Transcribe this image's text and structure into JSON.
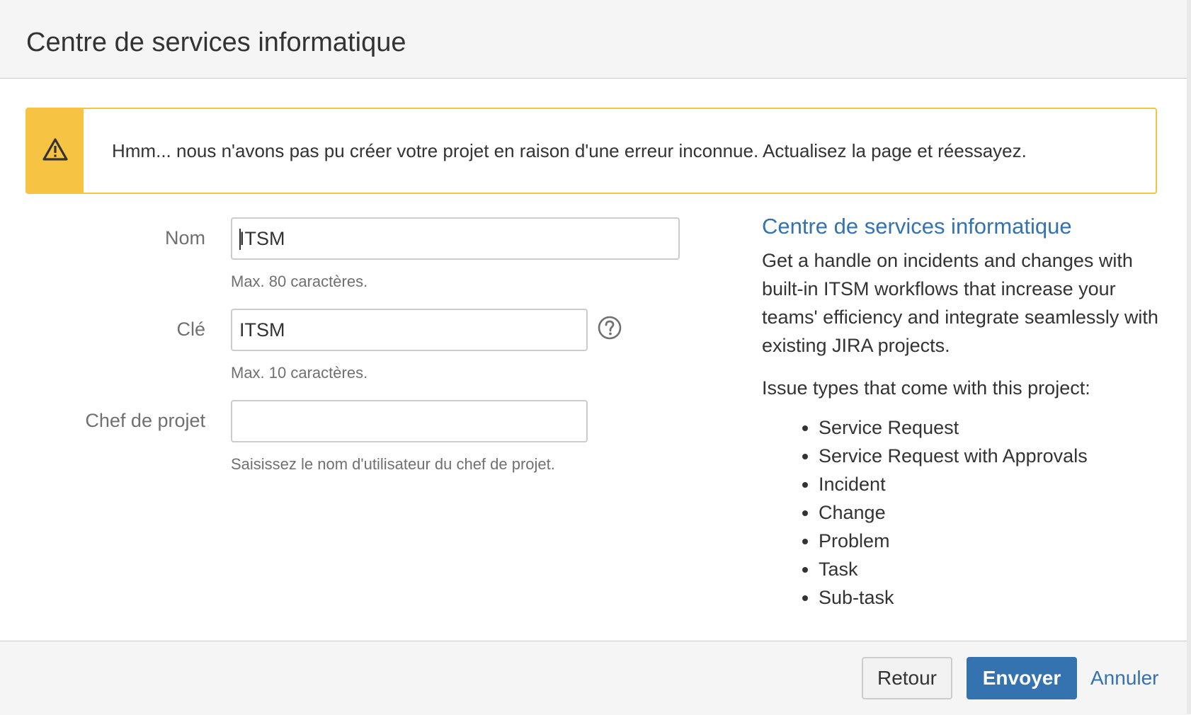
{
  "dialog": {
    "title": "Centre de services informatique"
  },
  "warning": {
    "icon": "warning-triangle-icon",
    "message": "Hmm... nous n'avons pas pu créer votre projet en raison d'une erreur inconnue. Actualisez la page et réessayez.",
    "color": "#f6c342"
  },
  "form": {
    "name": {
      "label": "Nom",
      "value": "ITSM",
      "hint": "Max. 80 caractères."
    },
    "key": {
      "label": "Clé",
      "value": "ITSM",
      "hint": "Max. 10 caractères.",
      "help_icon": "question-circle-icon"
    },
    "lead": {
      "label": "Chef de projet",
      "value": "",
      "hint": "Saisissez le nom d'utilisateur du chef de projet."
    }
  },
  "info": {
    "title": "Centre de services informatique",
    "description": "Get a handle on incidents and changes with built-in ITSM workflows that increase your teams' efficiency and integrate seamlessly with existing JIRA projects.",
    "issue_types_heading": "Issue types that come with this project:",
    "issue_types": [
      "Service Request",
      "Service Request with Approvals",
      "Incident",
      "Change",
      "Problem",
      "Task",
      "Sub-task"
    ]
  },
  "footer": {
    "back_label": "Retour",
    "submit_label": "Envoyer",
    "cancel_label": "Annuler"
  },
  "colors": {
    "accent": "#3572b0",
    "warning": "#f6c342"
  }
}
